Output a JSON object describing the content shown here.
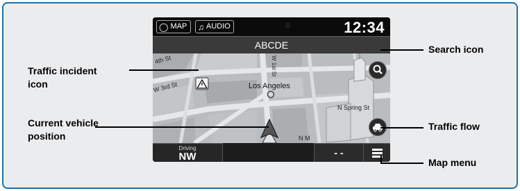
{
  "screen": {
    "map_button_label": "MAP",
    "audio_button_label": "AUDIO",
    "dim_indicator": "0",
    "clock": "12:34",
    "street_name": "ABCDE",
    "map": {
      "city_label": "Los Angeles",
      "streets": {
        "fourth_st": "4th St",
        "w_third_st": "W 3rd St",
        "w_first_st": "W 1st St",
        "n_spring_st": "N Spring St",
        "n_m": "N M"
      }
    },
    "heading_label": "Driving",
    "heading_value": "NW",
    "distance_value": "- -"
  },
  "callouts": {
    "traffic_incident_line1": "Traffic incident",
    "traffic_incident_line2": "icon",
    "current_vehicle_line1": "Current vehicle",
    "current_vehicle_line2": "position",
    "search_icon": "Search icon",
    "traffic_flow": "Traffic flow",
    "map_menu": "Map menu"
  },
  "icons": {
    "map_button": "navigation-arrow-icon",
    "audio_button": "music-note-icon",
    "search": "search-icon",
    "traffic_flow": "car-icon",
    "traffic_incident": "warning-icon",
    "vehicle": "vehicle-arrow-icon",
    "menu": "hamburger-menu-icon"
  },
  "colors": {
    "frame_border": "#1d6fa8",
    "frame_background": "#ebeced"
  }
}
